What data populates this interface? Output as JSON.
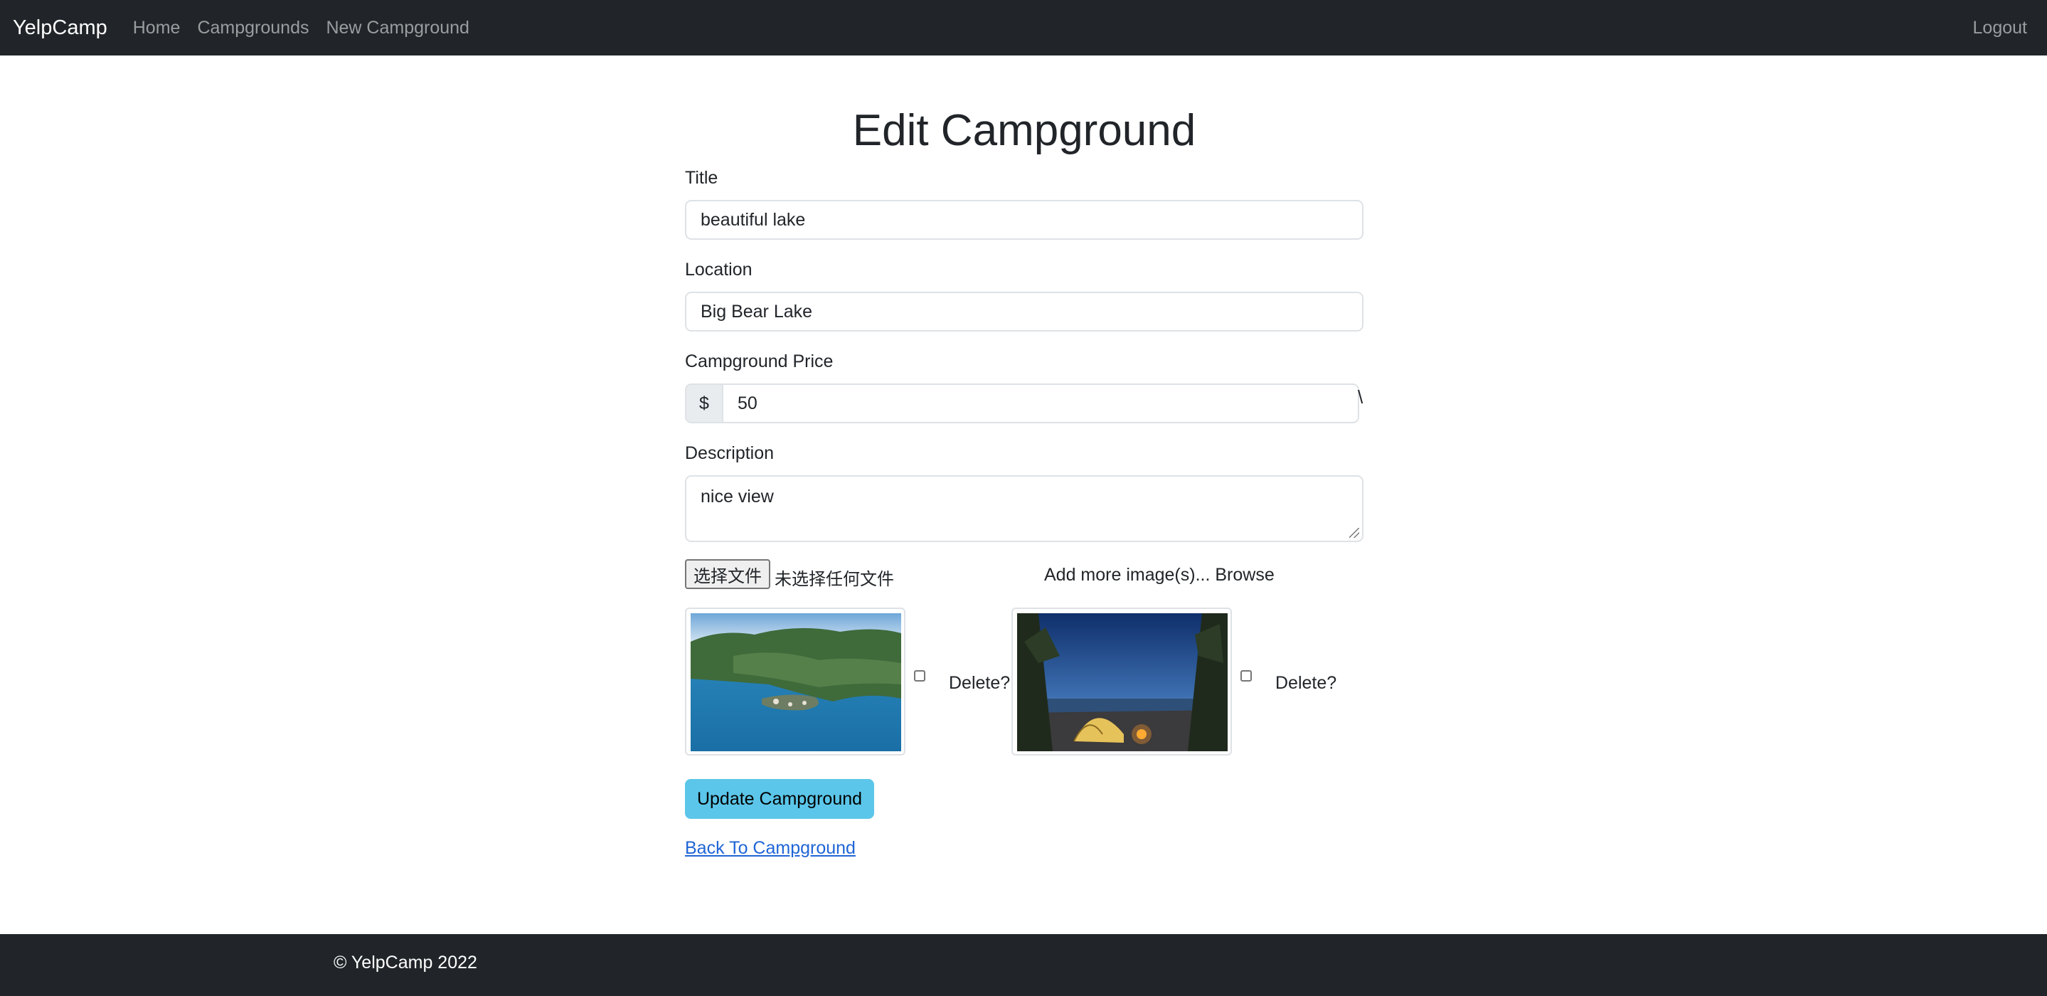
{
  "navbar": {
    "brand": "YelpCamp",
    "links": [
      "Home",
      "Campgrounds",
      "New Campground"
    ],
    "logout": "Logout"
  },
  "page": {
    "heading": "Edit Campground"
  },
  "form": {
    "title_label": "Title",
    "title_value": "beautiful lake",
    "location_label": "Location",
    "location_value": "Big Bear Lake",
    "price_label": "Campground Price",
    "price_prefix": "$",
    "price_value": "50",
    "stray_char": "\\",
    "description_label": "Description",
    "description_value": "nice view",
    "file_button": "选择文件",
    "file_status": "未选择任何文件",
    "browse_label": "Add more image(s)... Browse",
    "images": [
      {
        "alt": "lake-island-photo",
        "delete_label": "Delete?",
        "checked": false
      },
      {
        "alt": "tent-campfire-photo",
        "delete_label": "Delete?",
        "checked": false
      }
    ],
    "submit": "Update Campground",
    "back_link": "Back To Campground"
  },
  "footer": {
    "text": "© YelpCamp 2022"
  },
  "colors": {
    "navbar_bg": "#212529",
    "button_info": "#5bc6e9",
    "link": "#1f65d6"
  }
}
